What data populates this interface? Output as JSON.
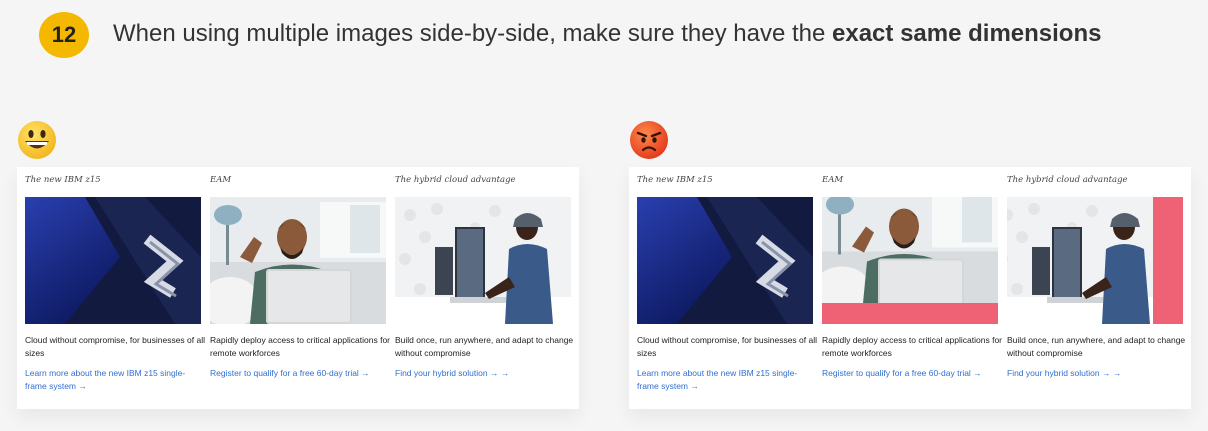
{
  "tip": {
    "number": "12",
    "text_prefix": "When using multiple images side-by-side, make sure they have the ",
    "text_bold": "exact same dimensions"
  },
  "examples": {
    "good": {
      "emoji_icon": "grinning-face-icon",
      "cards": [
        {
          "title": "The new IBM z15",
          "image": "z15-logo-photo",
          "description": "Cloud without compromise, for businesses of all sizes",
          "link": "Learn more about the new IBM z15 single-frame system →"
        },
        {
          "title": "EAM",
          "image": "man-waving-at-laptop-photo",
          "description": "Rapidly deploy access to critical applications for remote workforces",
          "link": "Register to qualify for a free 60-day trial →"
        },
        {
          "title": "The hybrid cloud advantage",
          "image": "man-at-computer-desk-photo",
          "description": "Build once, run anywhere, and adapt to change without compromise",
          "link": "Find your hybrid solution → →"
        }
      ]
    },
    "bad": {
      "emoji_icon": "angry-face-icon",
      "cards": [
        {
          "title": "The new IBM z15",
          "image": "z15-logo-photo",
          "description": "Cloud without compromise, for businesses of all sizes",
          "link": "Learn more about the new IBM z15 single-frame system →"
        },
        {
          "title": "EAM",
          "image": "man-waving-at-laptop-photo",
          "description": "Rapidly deploy access to critical applications for remote workforces",
          "link": "Register to qualify for a free 60-day trial →"
        },
        {
          "title": "The hybrid cloud advantage",
          "image": "man-at-computer-desk-photo",
          "description": "Build once, run anywhere, and adapt to change without compromise",
          "link": "Find your hybrid solution → →"
        }
      ]
    }
  },
  "colors": {
    "badge": "#f5b800",
    "link": "#2f6fd1",
    "mismatch_highlight": "#ef6275"
  }
}
